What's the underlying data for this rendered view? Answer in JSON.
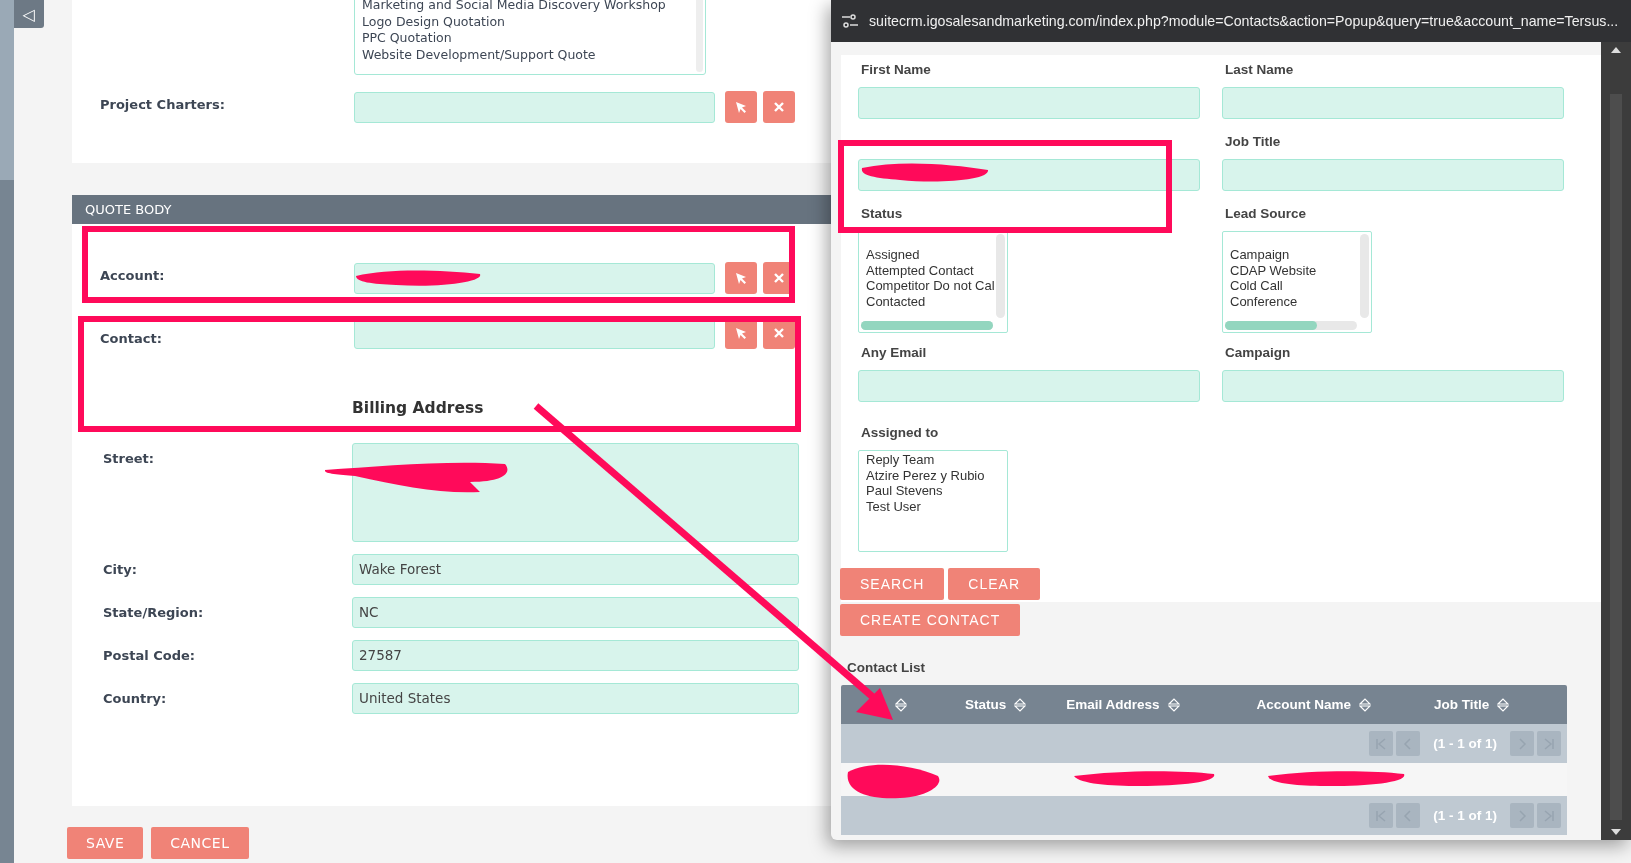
{
  "sidebar_toggle": "◁",
  "linked_list": {
    "items": [
      "Marketing and Social Media Discovery Workshop",
      "Logo Design Quotation",
      "PPC Quotation",
      "Website Development/Support Quote"
    ]
  },
  "project_charters": {
    "label": "Project Charters:"
  },
  "quote_body": {
    "title": "QUOTE BODY",
    "relations": [
      {
        "label": "Account:"
      },
      {
        "label": "Contact:"
      }
    ],
    "billing_address": {
      "title": "Billing Address",
      "fields": [
        {
          "label": "Street:",
          "kind": "textarea"
        },
        {
          "label": "City:",
          "kind": "text",
          "value": "Wake Forest"
        },
        {
          "label": "State/Region:",
          "kind": "text",
          "value": "NC"
        },
        {
          "label": "Postal Code:",
          "kind": "text",
          "value": "27587"
        },
        {
          "label": "Country:",
          "kind": "text",
          "value": "United States"
        }
      ]
    }
  },
  "actions": [
    "SAVE",
    "CANCEL"
  ],
  "popup": {
    "url": "suitecrm.igosalesandmarketing.com/index.php?module=Contacts&action=Popup&query=true&account_name=Tersus...",
    "search_fields": [
      {
        "label": "First Name",
        "kind": "text"
      },
      {
        "label": "Last Name",
        "kind": "text"
      },
      {
        "kind": "text"
      },
      {
        "label": "Job Title",
        "kind": "text"
      },
      {
        "label": "Status",
        "kind": "select",
        "options": [
          "Assigned",
          "Attempted Contact",
          "Competitor Do not Cal",
          "Contacted"
        ]
      },
      {
        "label": "Lead Source",
        "kind": "select",
        "options": [
          "Campaign",
          "CDAP Website",
          "Cold Call",
          "Conference"
        ]
      },
      {
        "label": "Any Email",
        "kind": "text"
      },
      {
        "label": "Campaign",
        "kind": "text"
      },
      {
        "label": "Assigned to",
        "kind": "select",
        "options": [
          "Reply Team",
          "Atzire Perez y Rubio",
          "Paul Stevens",
          "Test User"
        ]
      }
    ],
    "search_buttons": [
      "SEARCH",
      "CLEAR"
    ],
    "create_button": "CREATE CONTACT",
    "list_title": "Contact List",
    "columns": [
      "Status",
      "Email Address",
      "Account Name",
      "Job Title"
    ],
    "pager": [
      "(1 - 1 of 1)",
      "(1 - 1 of 1)"
    ]
  }
}
